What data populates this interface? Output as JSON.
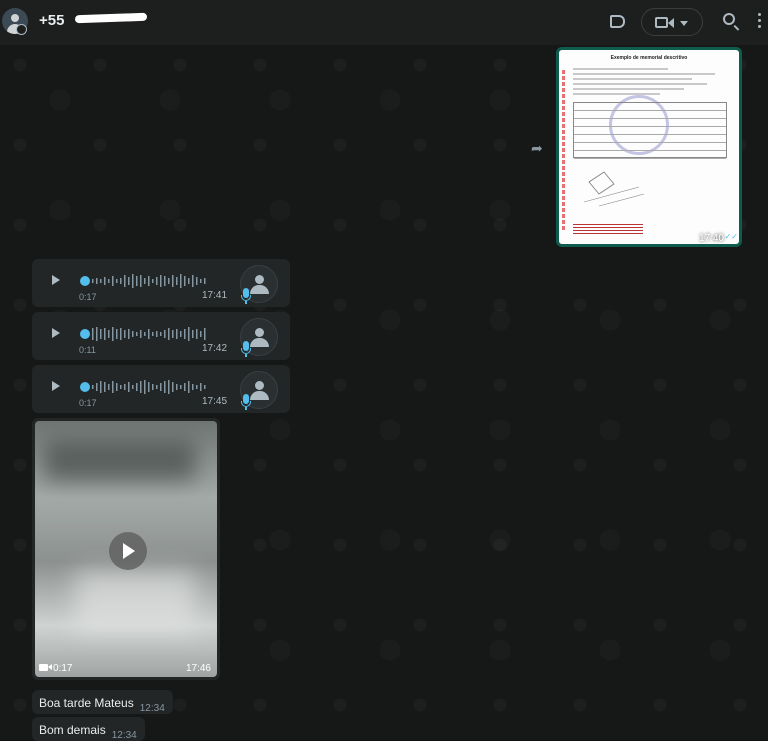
{
  "header": {
    "contact_name": "+55",
    "icons": [
      "label-icon",
      "video-call-icon",
      "chevron-down-icon",
      "search-icon",
      "menu-icon"
    ]
  },
  "document_message": {
    "title": "Exemplo de memorial descritivo",
    "time": "17:40",
    "forward_icon": "forward-icon"
  },
  "voice_messages": [
    {
      "duration": "0:17",
      "time": "17:41"
    },
    {
      "duration": "0:11",
      "time": "17:42"
    },
    {
      "duration": "0:17",
      "time": "17:45"
    }
  ],
  "video_message": {
    "duration": "0:17",
    "time": "17:46"
  },
  "text_messages": [
    {
      "text": "Boa tarde Mateus",
      "time": "12:34"
    },
    {
      "text": "Bom demais",
      "time": "12:34"
    }
  ],
  "colors": {
    "accent_blue": "#53bdeb",
    "bubble": "#232626",
    "header": "#1d1f1f",
    "doc_border": "#0f5c4c"
  }
}
